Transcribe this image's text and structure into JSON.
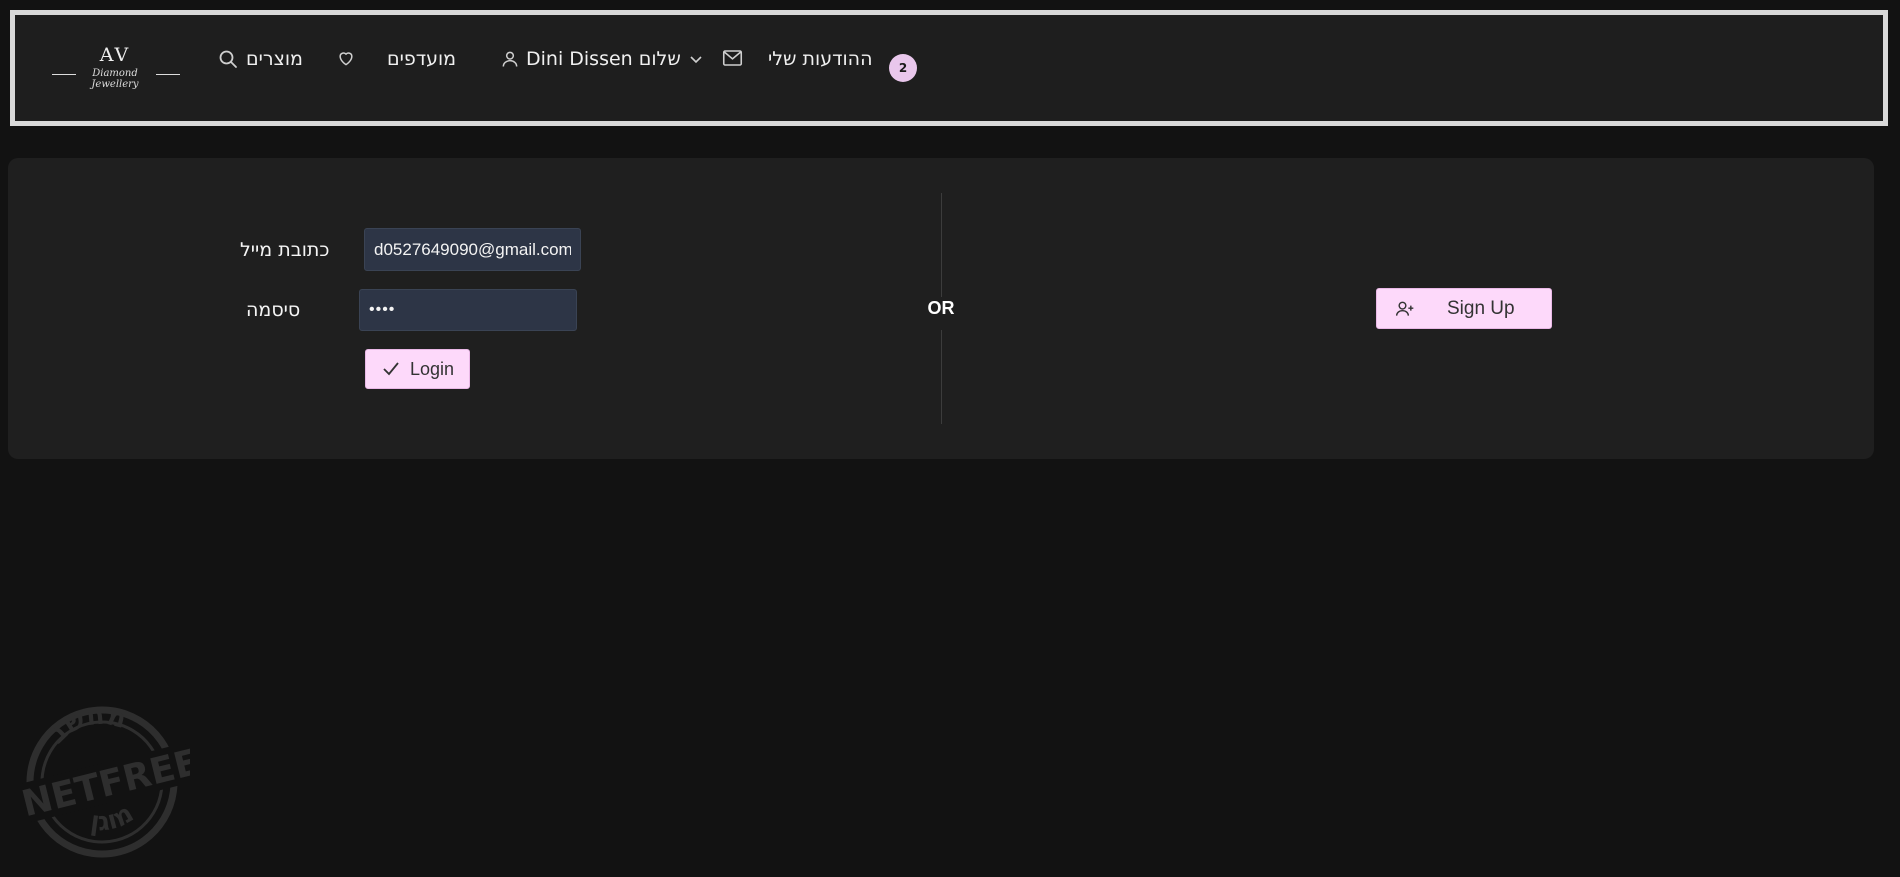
{
  "header": {
    "logo_monogram": "AV",
    "logo_script": "Diamond Jewellery",
    "nav": {
      "products": "מוצרים",
      "favorites": "מועדפים",
      "user_greeting": "שלום Dini Dissen",
      "messages": "ההודעות שלי",
      "messages_badge": "2"
    },
    "icons": [
      "search-icon",
      "heart-icon",
      "user-icon",
      "chevron-down-icon",
      "mail-icon"
    ]
  },
  "login": {
    "email_label": "כתובת מייל",
    "email_value": "d0527649090@gmail.com",
    "password_label": "סיסמה",
    "password_value": "1234",
    "login_button": "Login",
    "or_label": "OR",
    "signup_button": "Sign Up"
  },
  "watermark": {
    "top_text": "מחשב",
    "center_text": "NETFREE",
    "bottom_text": "מוגן"
  },
  "colors": {
    "background": "#121212",
    "header_bg": "#1e1e1e",
    "card_bg": "#1f1f1f",
    "accent_button": "#fdd9fa",
    "badge": "#e9c7ec",
    "input_bg": "#2d3546"
  }
}
